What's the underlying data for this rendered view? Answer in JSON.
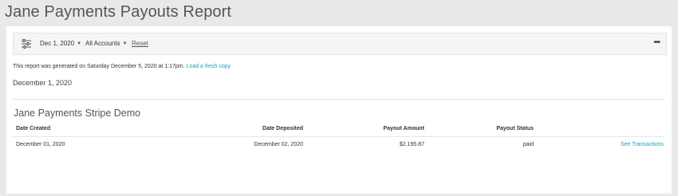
{
  "page": {
    "title": "Jane Payments Payouts Report"
  },
  "toolbar": {
    "date_filter": "Dec 1, 2020",
    "accounts_filter": "All Accounts",
    "reset_label": "Reset",
    "more_label": "•••"
  },
  "report": {
    "generated_text": "This report was generated on Saturday December 5, 2020 at 1:17pm.",
    "refresh_link": "Load a fresh copy",
    "date": "December 1, 2020"
  },
  "section": {
    "title": "Jane Payments Stripe Demo"
  },
  "table": {
    "headers": {
      "date_created": "Date Created",
      "date_deposited": "Date Deposited",
      "payout_amount": "Payout Amount",
      "payout_status": "Payout Status"
    },
    "rows": [
      {
        "date_created": "December 01, 2020",
        "date_deposited": "December 02, 2020",
        "payout_amount": "$2,195.87",
        "payout_status": "paid",
        "action": "See Transactions"
      }
    ]
  }
}
